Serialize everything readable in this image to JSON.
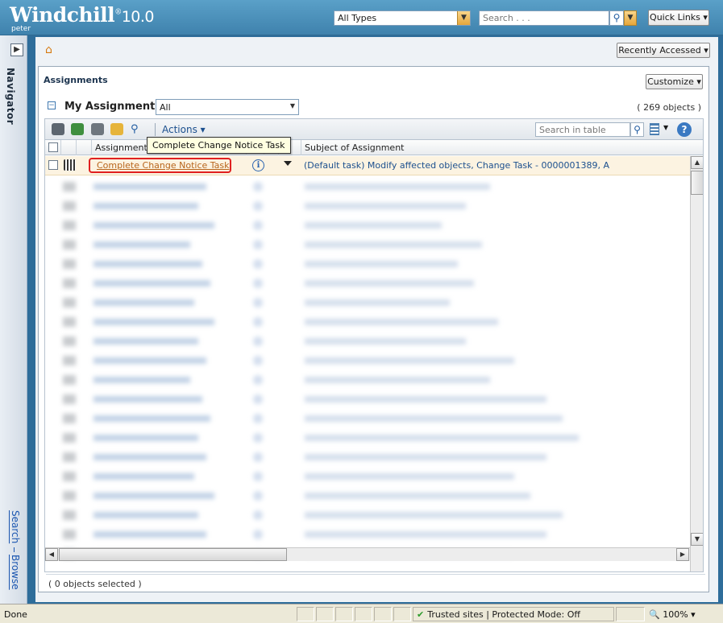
{
  "header": {
    "logo": "Windchill",
    "version": "10.0",
    "user": "peter",
    "type_select": "All Types",
    "search_placeholder": "Search . . .",
    "quick_links": "Quick Links"
  },
  "navigator": {
    "title": "Navigator",
    "search_link": "Search",
    "browse_link": "Browse"
  },
  "toolbar_top": {
    "recently_accessed": "Recently Accessed"
  },
  "panel": {
    "title": "Assignments",
    "customize": "Customize"
  },
  "table": {
    "title": "My Assignments",
    "view": "All",
    "object_count": "( 269 objects )",
    "actions_label": "Actions",
    "search_placeholder": "Search in table",
    "columns": [
      "Assignment Name",
      "Subject of Assignment"
    ],
    "first_row": {
      "name": "Complete Change Notice Task",
      "subject": "(Default task) Modify affected objects, Change Task - 0000001389, A"
    },
    "tooltip": "Complete Change Notice Task",
    "selected": "( 0 objects selected )"
  },
  "statusbar": {
    "done": "Done",
    "zone": "Trusted sites | Protected Mode: Off",
    "zoom": "100%"
  },
  "colors": {
    "header": "#3f82ad",
    "highlight_row": "#fcf3e1",
    "link": "#b8661c",
    "callout": "#e02020"
  }
}
